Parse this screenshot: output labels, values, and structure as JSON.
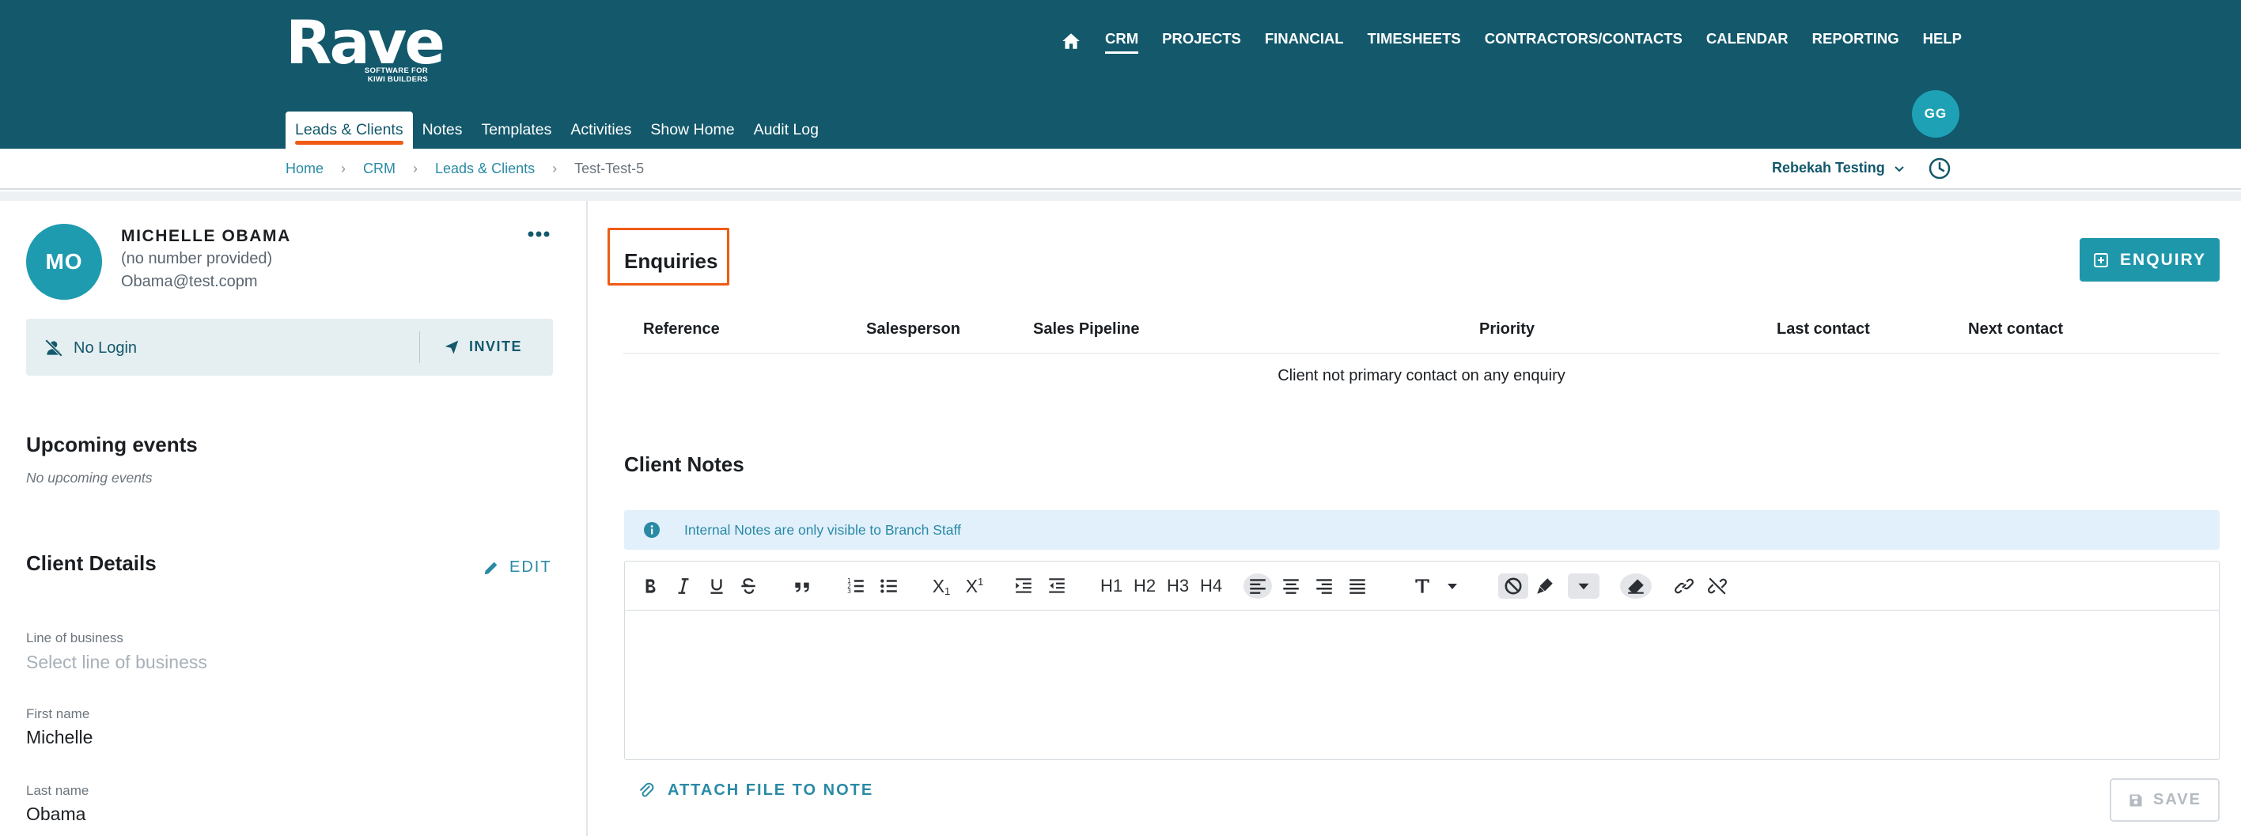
{
  "brand": {
    "name": "Rave",
    "tagline_line1": "SOFTWARE FOR",
    "tagline_line2": "KIWI BUILDERS"
  },
  "main_nav": {
    "items": [
      {
        "label": "CRM",
        "active": true
      },
      {
        "label": "PROJECTS"
      },
      {
        "label": "FINANCIAL"
      },
      {
        "label": "TIMESHEETS"
      },
      {
        "label": "CONTRACTORS/CONTACTS"
      },
      {
        "label": "CALENDAR"
      },
      {
        "label": "REPORTING"
      },
      {
        "label": "HELP"
      }
    ]
  },
  "user": {
    "initials": "GG"
  },
  "sub_nav": {
    "tabs": [
      {
        "label": "Leads & Clients",
        "active": true
      },
      {
        "label": "Notes"
      },
      {
        "label": "Templates"
      },
      {
        "label": "Activities"
      },
      {
        "label": "Show Home"
      },
      {
        "label": "Audit Log"
      }
    ]
  },
  "breadcrumb": {
    "items": [
      "Home",
      "CRM",
      "Leads & Clients"
    ],
    "current": "Test-Test-5"
  },
  "branch": {
    "selected": "Rebekah Testing"
  },
  "client": {
    "initials": "MO",
    "name": "MICHELLE OBAMA",
    "phone": "(no number provided)",
    "email": "Obama@test.copm",
    "login_status": "No Login",
    "invite_label": "INVITE"
  },
  "upcoming": {
    "title": "Upcoming events",
    "empty_text": "No upcoming events"
  },
  "details": {
    "title": "Client Details",
    "edit_label": "EDIT",
    "fields": [
      {
        "label": "Line of business",
        "placeholder": "Select line of business"
      },
      {
        "label": "First name",
        "value": "Michelle"
      },
      {
        "label": "Last name",
        "value": "Obama"
      }
    ]
  },
  "enquiries": {
    "title": "Enquiries",
    "add_button": "ENQUIRY",
    "columns": [
      "Reference",
      "Salesperson",
      "Sales Pipeline",
      "Priority",
      "Last contact",
      "Next contact"
    ],
    "empty_text": "Client not primary contact on any enquiry"
  },
  "notes": {
    "title": "Client Notes",
    "info": "Internal Notes are only visible to Branch Staff",
    "toolbar": {
      "h1": "H1",
      "h2": "H2",
      "h3": "H3",
      "h4": "H4",
      "sub_x": "X",
      "sub_n": "1",
      "sup_x": "X",
      "sup_n": "1"
    },
    "attach_label": "ATTACH FILE TO NOTE",
    "save_label": "SAVE"
  },
  "colors": {
    "header": "#13586b",
    "accent": "#1f97ab",
    "highlight": "#f05a14"
  }
}
